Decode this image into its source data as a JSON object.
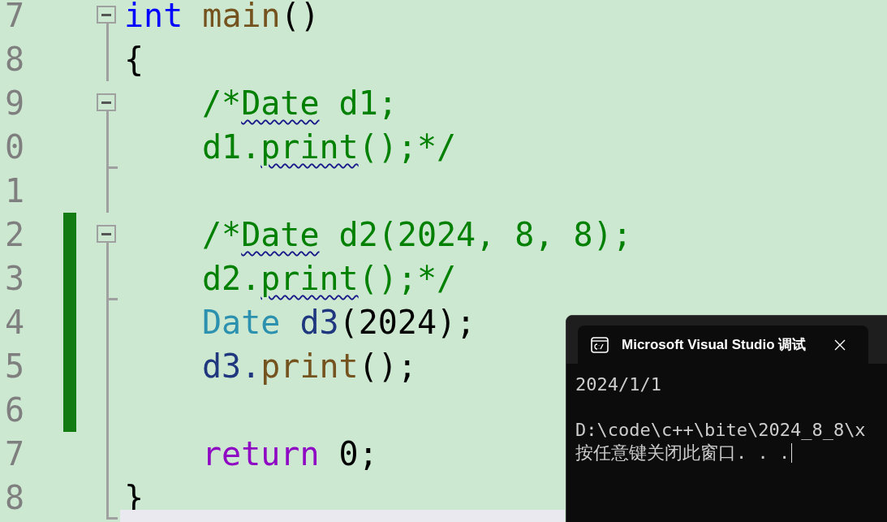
{
  "editor": {
    "lines": [
      {
        "number": "7",
        "fold_start": true,
        "fold_end": false,
        "changed": false,
        "indent": false,
        "tokens": [
          {
            "kind": "keyword",
            "text": "int"
          },
          {
            "kind": "function",
            "text": "main",
            "spaced": true
          },
          {
            "kind": "plain",
            "text": "()"
          }
        ]
      },
      {
        "number": "8",
        "fold_start": false,
        "fold_end": false,
        "changed": false,
        "indent": false,
        "tokens": [
          {
            "kind": "plain",
            "text": "{"
          }
        ]
      },
      {
        "number": "9",
        "fold_start": true,
        "fold_end": false,
        "changed": false,
        "indent": true,
        "tokens": [
          {
            "kind": "comment",
            "text": "/*"
          },
          {
            "kind": "comment",
            "text": "Date",
            "squiggle": true
          },
          {
            "kind": "comment",
            "text": "d1;",
            "spaced": true
          }
        ]
      },
      {
        "number": "0",
        "fold_start": false,
        "fold_end": true,
        "changed": false,
        "indent": true,
        "tokens": [
          {
            "kind": "comment",
            "text": "d1."
          },
          {
            "kind": "comment",
            "text": "print",
            "squiggle": true
          },
          {
            "kind": "comment",
            "text": "();*/"
          }
        ]
      },
      {
        "number": "1",
        "fold_start": false,
        "fold_end": false,
        "changed": false,
        "indent": false
      },
      {
        "number": "2",
        "fold_start": true,
        "fold_end": false,
        "changed": true,
        "indent": true,
        "tokens": [
          {
            "kind": "comment",
            "text": "/*"
          },
          {
            "kind": "comment",
            "text": "Date",
            "squiggle": true
          },
          {
            "kind": "comment",
            "text": "d2(2024, 8, 8);",
            "spaced": true
          }
        ]
      },
      {
        "number": "3",
        "fold_start": false,
        "fold_end": true,
        "changed": true,
        "indent": true,
        "tokens": [
          {
            "kind": "comment",
            "text": "d2."
          },
          {
            "kind": "comment",
            "text": "print",
            "squiggle": true
          },
          {
            "kind": "comment",
            "text": "();*/"
          }
        ]
      },
      {
        "number": "4",
        "fold_start": false,
        "fold_end": false,
        "changed": true,
        "indent": true,
        "tokens": [
          {
            "kind": "type",
            "text": "Date"
          },
          {
            "kind": "variable",
            "text": "d3",
            "spaced": true
          },
          {
            "kind": "plain",
            "text": "(2024);"
          }
        ]
      },
      {
        "number": "5",
        "fold_start": false,
        "fold_end": false,
        "changed": true,
        "indent": true,
        "tokens": [
          {
            "kind": "variable",
            "text": "d3."
          },
          {
            "kind": "function",
            "text": "print"
          },
          {
            "kind": "plain",
            "text": "();"
          }
        ]
      },
      {
        "number": "6",
        "fold_start": false,
        "fold_end": false,
        "changed": true,
        "indent": false
      },
      {
        "number": "7",
        "fold_start": false,
        "fold_end": false,
        "changed": false,
        "indent": true,
        "tokens": [
          {
            "kind": "control",
            "text": "return"
          },
          {
            "kind": "plain",
            "text": "0;",
            "spaced": true
          }
        ]
      },
      {
        "number": "8",
        "fold_start": false,
        "fold_end": true,
        "changed": false,
        "indent": false,
        "tokens": [
          {
            "kind": "plain",
            "text": "}"
          }
        ]
      }
    ]
  },
  "console": {
    "tab_title": "Microsoft Visual Studio 调试",
    "output": "2024/1/1",
    "lines": [
      "D:\\code\\c++\\bite\\2024_8_8\\x",
      "按任意键关闭此窗口. . ."
    ]
  }
}
